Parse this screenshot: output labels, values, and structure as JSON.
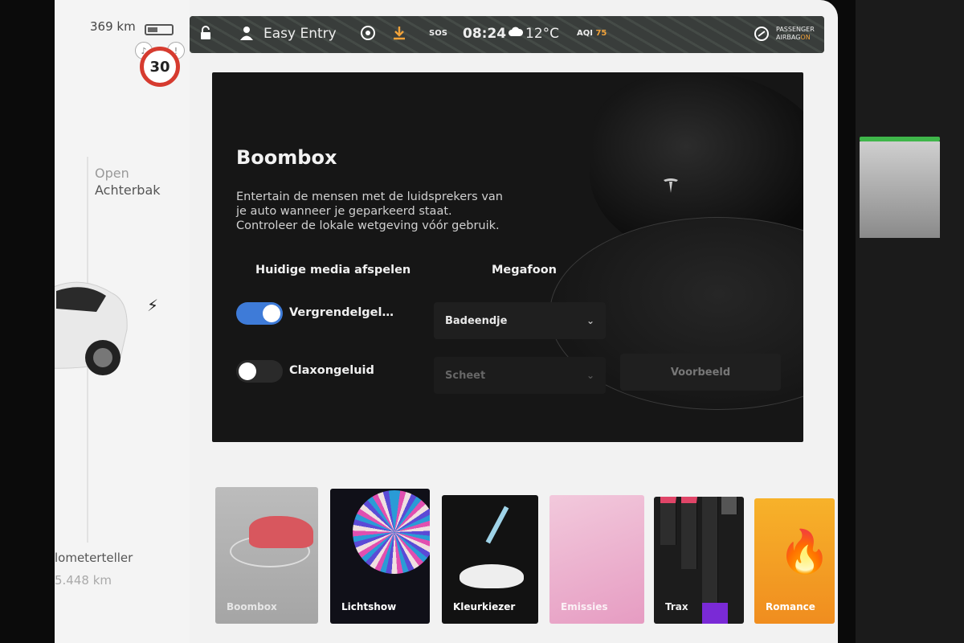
{
  "vehicle": {
    "range": "369 km",
    "speed_limit": "30",
    "trunk_line1": "Open",
    "trunk_line2": "Achterbak",
    "odometer_label": "lometerteller",
    "odometer_value": "5.448 km"
  },
  "status_bar": {
    "profile": "Easy Entry",
    "sos": "SOS",
    "time": "08:24",
    "temperature": "12°C",
    "aqi_label": "AQI",
    "aqi_value": "75",
    "airbag_line1": "PASSENGER",
    "airbag_line2": "AIRBAG",
    "airbag_state": "ON"
  },
  "boombox": {
    "title": "Boombox",
    "description_lines": [
      "Entertain de mensen met de luidsprekers van",
      "je auto wanneer je geparkeerd staat.",
      "Controleer de lokale wetgeving vóór gebruik."
    ],
    "col_media": "Huidige media afspelen",
    "col_megaphone": "Megafoon",
    "option_lock_sound": {
      "label": "Vergrendelgel…",
      "on": true
    },
    "option_horn_sound": {
      "label": "Claxongeluid",
      "on": false
    },
    "select_lock_sound": "Badeendje",
    "select_horn_sound": "Scheet",
    "preview_button": "Voorbeeld"
  },
  "tiles": [
    {
      "label": "Boombox"
    },
    {
      "label": "Lichtshow"
    },
    {
      "label": "Kleurkiezer"
    },
    {
      "label": "Emissies"
    },
    {
      "label": "Trax"
    },
    {
      "label": "Romance"
    }
  ],
  "colors": {
    "toggle_on": "#3e7bd8",
    "speed_ring": "#d63b2f",
    "aqi": "#f2a33a"
  },
  "icons": [
    "lock-icon",
    "person-icon",
    "dashcam-icon",
    "download-icon",
    "cloud-icon",
    "airbag-icon",
    "bolt-icon",
    "chevron-down-icon",
    "tesla-logo-icon"
  ]
}
